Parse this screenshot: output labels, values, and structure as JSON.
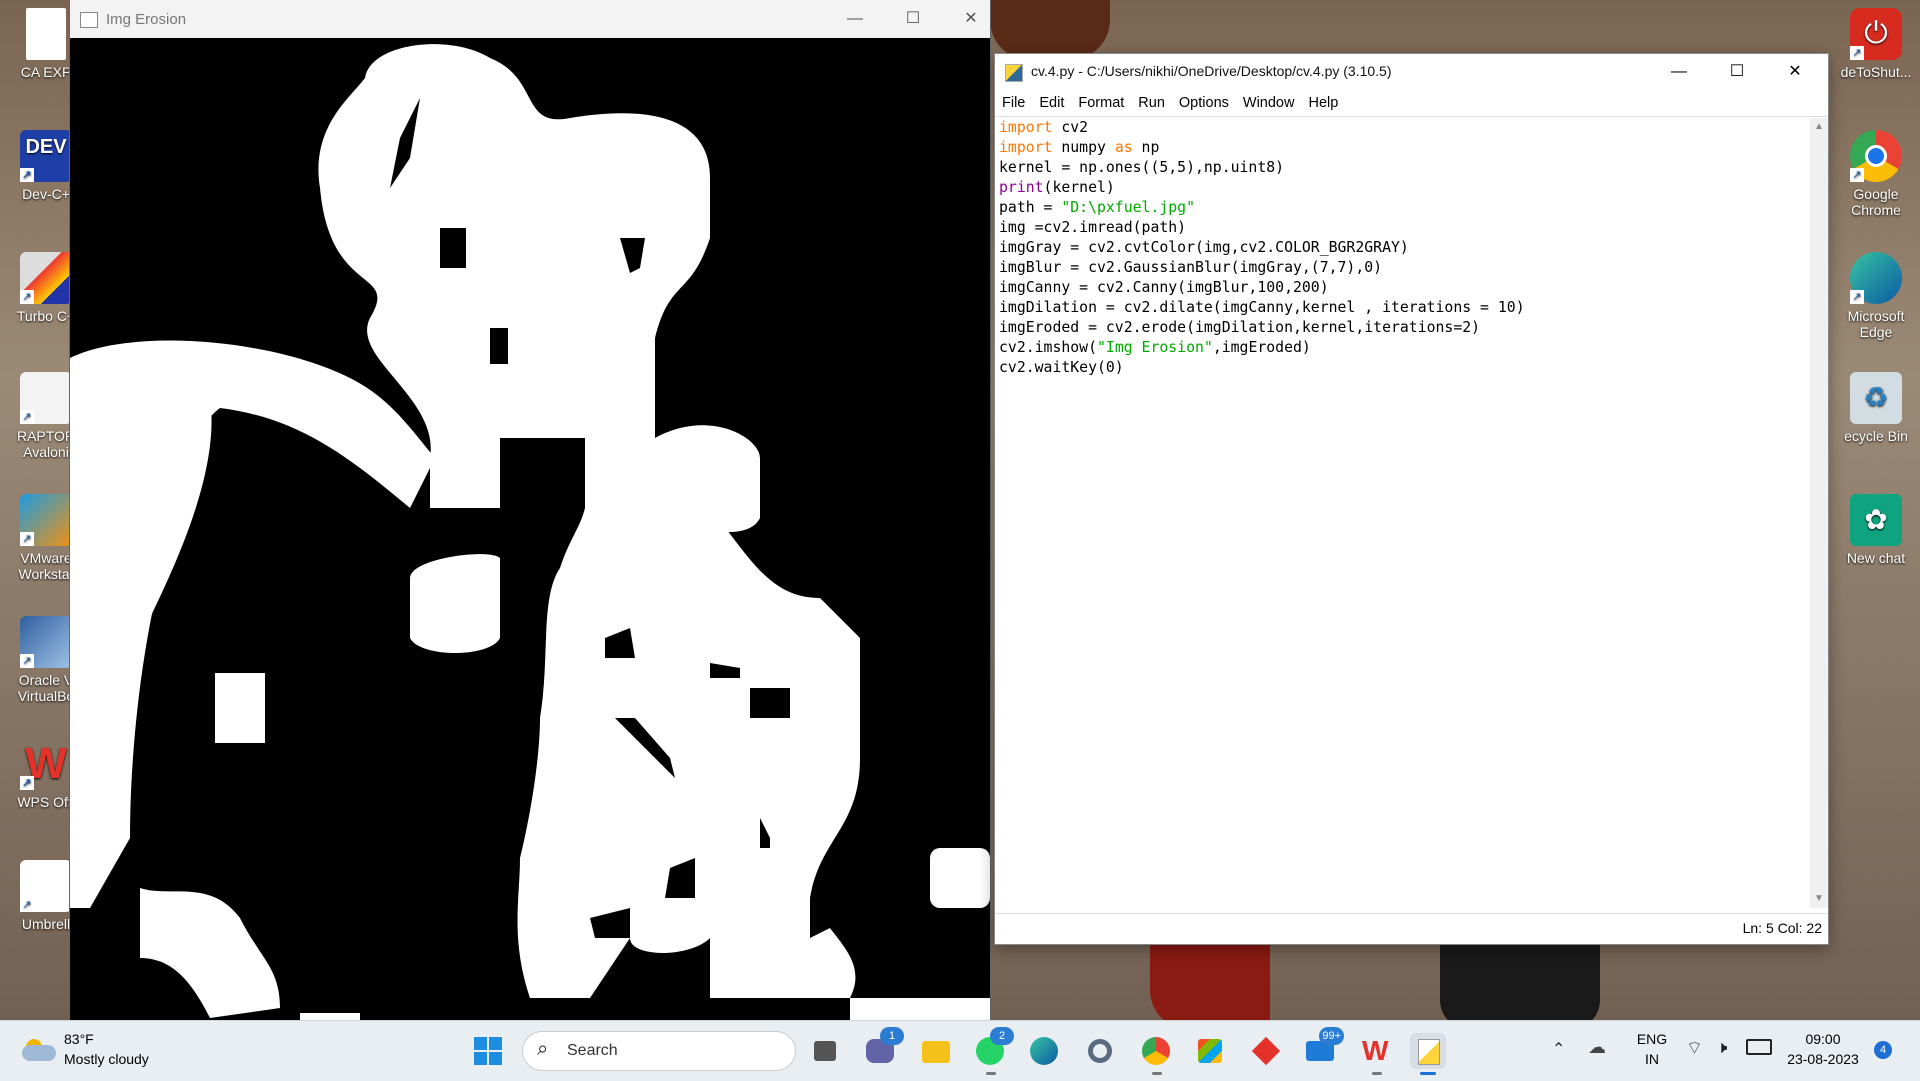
{
  "desktop": {
    "left_icons": [
      {
        "label": "CA EXP"
      },
      {
        "label": "Dev-C+"
      },
      {
        "label": "Turbo C+"
      },
      {
        "label": "RAPTOR Avaloni"
      },
      {
        "label": "VMware Workstat"
      },
      {
        "label": "Oracle V VirtualBo"
      },
      {
        "label": "WPS Offi"
      },
      {
        "label": "Umbrell"
      }
    ],
    "right_icons": [
      {
        "label": "deToShut..."
      },
      {
        "label": "Google Chrome"
      },
      {
        "label": "Microsoft Edge"
      },
      {
        "label": "ecycle Bin"
      },
      {
        "label": "New chat"
      }
    ]
  },
  "image_window": {
    "title": "Img Erosion",
    "controls": {
      "minimize": "—",
      "maximize": "☐",
      "close": "✕"
    }
  },
  "idle_window": {
    "title": "cv.4.py - C:/Users/nikhi/OneDrive/Desktop/cv.4.py (3.10.5)",
    "controls": {
      "minimize": "—",
      "maximize": "☐",
      "close": "✕"
    },
    "menu": [
      "File",
      "Edit",
      "Format",
      "Run",
      "Options",
      "Window",
      "Help"
    ],
    "code": [
      [
        {
          "t": "import",
          "c": "kw"
        },
        {
          "t": " cv2",
          "c": ""
        }
      ],
      [
        {
          "t": "import",
          "c": "kw"
        },
        {
          "t": " numpy ",
          "c": ""
        },
        {
          "t": "as",
          "c": "kw"
        },
        {
          "t": " np",
          "c": ""
        }
      ],
      [
        {
          "t": "kernel = np.ones((5,5),np.uint8)",
          "c": ""
        }
      ],
      [
        {
          "t": "print",
          "c": "bi"
        },
        {
          "t": "(kernel)",
          "c": ""
        }
      ],
      [
        {
          "t": "path = ",
          "c": ""
        },
        {
          "t": "\"D:\\pxfuel.jpg\"",
          "c": "str"
        }
      ],
      [
        {
          "t": "img =cv2.imread(path)",
          "c": ""
        }
      ],
      [
        {
          "t": "imgGray = cv2.cvtColor(img,cv2.COLOR_BGR2GRAY)",
          "c": ""
        }
      ],
      [
        {
          "t": "imgBlur = cv2.GaussianBlur(imgGray,(7,7),0)",
          "c": ""
        }
      ],
      [
        {
          "t": "imgCanny = cv2.Canny(imgBlur,100,200)",
          "c": ""
        }
      ],
      [
        {
          "t": "imgDilation = cv2.dilate(imgCanny,kernel , iterations = 10)",
          "c": ""
        }
      ],
      [
        {
          "t": "imgEroded = cv2.erode(imgDilation,kernel,iterations=2)",
          "c": ""
        }
      ],
      [
        {
          "t": "cv2.imshow(",
          "c": ""
        },
        {
          "t": "\"Img Erosion\"",
          "c": "str"
        },
        {
          "t": ",imgEroded)",
          "c": ""
        }
      ],
      [
        {
          "t": "cv2.waitKey(0)",
          "c": ""
        }
      ]
    ],
    "status": "Ln: 5   Col: 22"
  },
  "taskbar": {
    "weather": {
      "temp": "83°F",
      "desc": "Mostly cloudy"
    },
    "search_label": "Search",
    "badges": {
      "teams": "1",
      "whatsapp": "2",
      "mail": "99+",
      "notifications": "4"
    },
    "tray": {
      "lang_line1": "ENG",
      "lang_line2": "IN",
      "time": "09:00",
      "date": "23-08-2023"
    }
  },
  "colors": {
    "keyword": "#ff7700",
    "builtin": "#900090",
    "string": "#00aa00",
    "taskbar": "#e9eef3"
  }
}
